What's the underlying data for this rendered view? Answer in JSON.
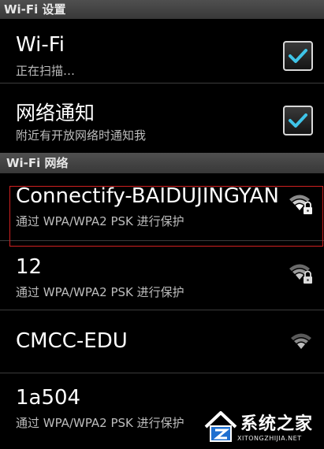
{
  "header": {
    "title": "Wi-Fi 设置"
  },
  "settings": [
    {
      "title": "Wi-Fi",
      "subtitle": "正在扫描…",
      "checked": true
    },
    {
      "title": "网络通知",
      "subtitle": "附近有开放网络时通知我",
      "checked": true
    }
  ],
  "networks_header": {
    "title": "Wi-Fi 网络"
  },
  "networks": [
    {
      "name": "Connectify-BAIDUJINGYAN",
      "security": "通过 WPA/WPA2 PSK 进行保护",
      "icon": "wifi-lock-icon",
      "selected": true
    },
    {
      "name": "12",
      "security": "通过 WPA/WPA2 PSK 进行保护",
      "icon": "wifi-lock-icon"
    },
    {
      "name": "CMCC-EDU",
      "security": "",
      "icon": "wifi-open-icon"
    },
    {
      "name": "1a504",
      "security": "通过 WPA/WPA2 PSK 进行保护",
      "icon": "wifi-lock-icon"
    }
  ],
  "watermark": {
    "name": "系统之家",
    "url": "XITONGZHIJIA.NET",
    "icon": "house-logo-icon"
  },
  "colors": {
    "check": "#3fc4e8",
    "selection_border": "#d02020",
    "header_bg": "#434343"
  }
}
